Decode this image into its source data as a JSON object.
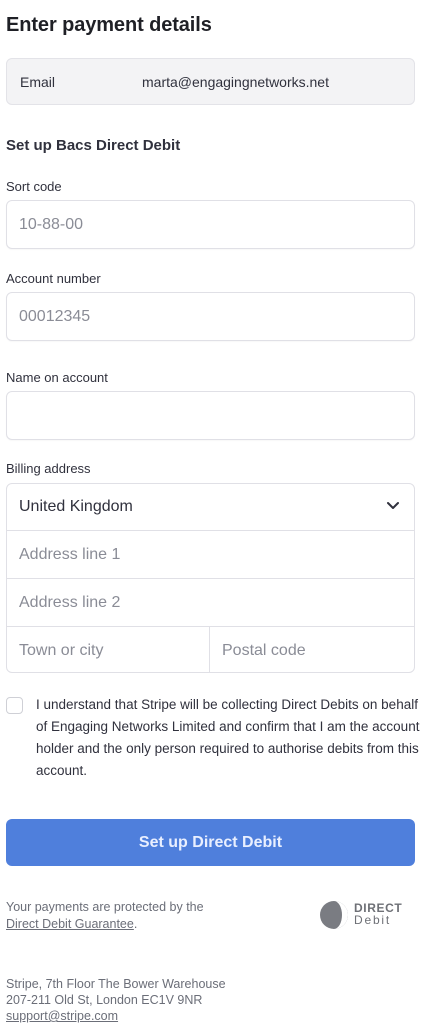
{
  "title": "Enter payment details",
  "email": {
    "label": "Email",
    "value": "marta@engagingnetworks.net"
  },
  "section_title": "Set up Bacs Direct Debit",
  "sort_code": {
    "label": "Sort code",
    "placeholder": "10-88-00"
  },
  "account_number": {
    "label": "Account number",
    "placeholder": "00012345"
  },
  "name_on_account": {
    "label": "Name on account",
    "placeholder": ""
  },
  "billing": {
    "label": "Billing address",
    "country": "United Kingdom",
    "line1_placeholder": "Address line 1",
    "line2_placeholder": "Address line 2",
    "town_placeholder": "Town or city",
    "postal_placeholder": "Postal code"
  },
  "consent": "I understand that Stripe will be collecting Direct Debits on behalf of Engaging Networks Limited and confirm that I am the account holder and the only person required to authorise debits from this account.",
  "submit_label": "Set up Direct Debit",
  "guarantee": {
    "text": "Your payments are protected by the",
    "link": "Direct Debit Guarantee",
    "suffix": "."
  },
  "dd_logo": {
    "line1": "DIRECT",
    "line2": "Debit"
  },
  "footer": {
    "line1": "Stripe, 7th Floor The Bower Warehouse",
    "line2": "207-211 Old St, London EC1V 9NR",
    "email": "support@stripe.com"
  },
  "colors": {
    "accent": "#4f7fdc",
    "text": "#30313d",
    "muted": "#6b6e78",
    "border": "#e0e0e6"
  }
}
